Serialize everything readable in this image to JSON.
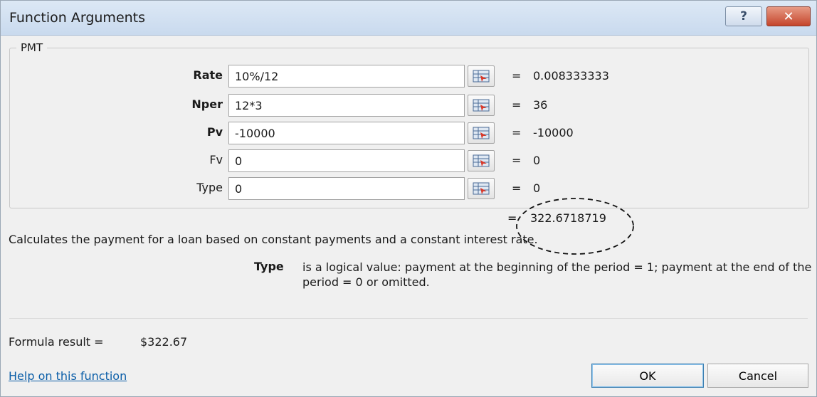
{
  "window": {
    "title": "Function Arguments"
  },
  "title_buttons": {
    "help_glyph": "?",
    "close_glyph": "✕"
  },
  "function_name": "PMT",
  "arguments": [
    {
      "label": "Rate",
      "bold": true,
      "value": "10%/12",
      "result": "0.008333333"
    },
    {
      "label": "Nper",
      "bold": true,
      "value": "12*3",
      "result": "36"
    },
    {
      "label": "Pv",
      "bold": true,
      "value": "-10000",
      "result": "-10000"
    },
    {
      "label": "Fv",
      "bold": false,
      "value": "0",
      "result": "0"
    },
    {
      "label": "Type",
      "bold": false,
      "value": "0",
      "result": "0"
    }
  ],
  "equals_sign": "=",
  "function_result": "322.6718719",
  "description": "Calculates the payment for a loan based on constant payments and a constant interest rate.",
  "param_help": {
    "name": "Type",
    "text": "is a logical value: payment at the beginning of the period = 1; payment at the end of the period = 0 or omitted."
  },
  "formula_result": {
    "label": "Formula result =",
    "value": "$322.67"
  },
  "help_link": "Help on this function",
  "buttons": {
    "ok": "OK",
    "cancel": "Cancel"
  }
}
